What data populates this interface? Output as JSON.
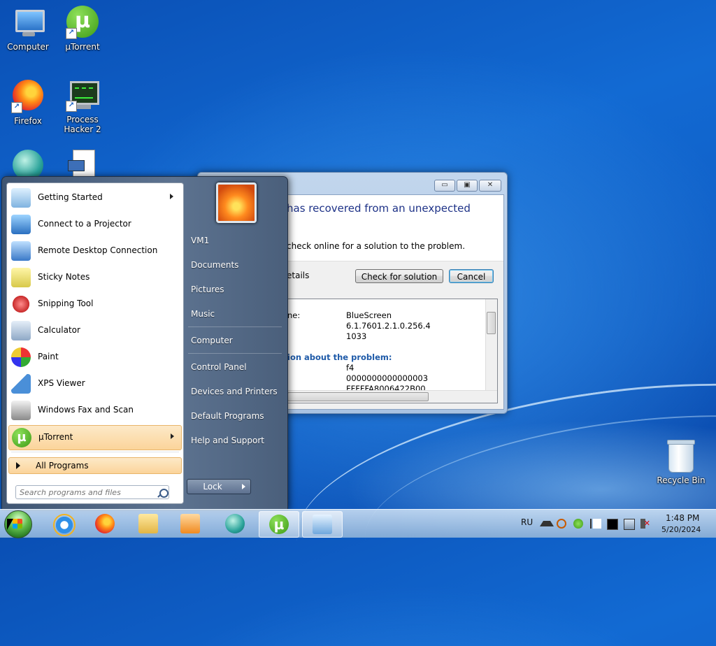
{
  "desktop": {
    "icons": {
      "computer": "Computer",
      "utorrent": "µTorrent",
      "firefox": "Firefox",
      "process_hacker": "Process Hacker 2",
      "recycle_bin": "Recycle Bin"
    }
  },
  "dialog": {
    "title_text": "has recovered from an unexpected",
    "description": "check online for a solution to the problem.",
    "details_label": "etails",
    "check_button": "Check for solution",
    "cancel_button": "Cancel",
    "details": {
      "name_label": "ne:",
      "name_value": "BlueScreen",
      "version_value": "6.1.7601.2.1.0.256.4",
      "locale_value": "1033",
      "section_head": "ion about the problem:",
      "bccode": "f4",
      "bcp1": "0000000000000003",
      "bcp2": "FFFFFA8006422B00"
    }
  },
  "start_menu": {
    "programs": [
      {
        "label": "Getting Started"
      },
      {
        "label": "Connect to a Projector"
      },
      {
        "label": "Remote Desktop Connection"
      },
      {
        "label": "Sticky Notes"
      },
      {
        "label": "Snipping Tool"
      },
      {
        "label": "Calculator"
      },
      {
        "label": "Paint"
      },
      {
        "label": "XPS Viewer"
      },
      {
        "label": "Windows Fax and Scan"
      },
      {
        "label": "µTorrent"
      }
    ],
    "all_programs": "All Programs",
    "search_placeholder": "Search programs and files",
    "right": {
      "user": "VM1",
      "documents": "Documents",
      "pictures": "Pictures",
      "music": "Music",
      "computer": "Computer",
      "control_panel": "Control Panel",
      "devices": "Devices and Printers",
      "default_programs": "Default Programs",
      "help": "Help and Support"
    },
    "lock_button": "Lock"
  },
  "taskbar": {
    "language": "RU",
    "time": "1:48 PM",
    "date": "5/20/2024"
  },
  "colors": {
    "accent": "#1e3287",
    "highlight": "#fbd49a"
  }
}
